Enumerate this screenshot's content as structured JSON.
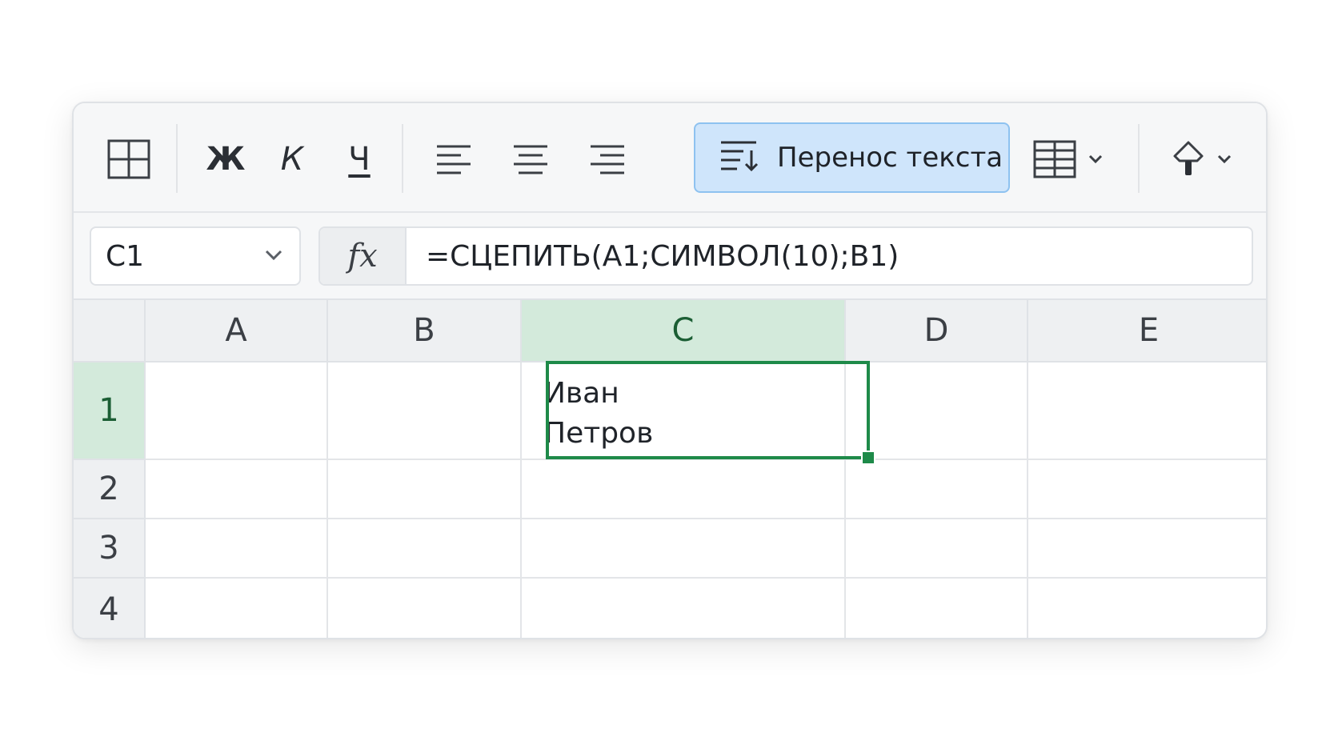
{
  "toolbar": {
    "bold_label": "Ж",
    "italic_label": "К",
    "underline_label": "Ч",
    "wrap_text_label": "Перенос текста",
    "icons": [
      "table-grid-icon",
      "align-left-icon",
      "align-center-icon",
      "align-right-icon",
      "wrap-text-icon",
      "borders-icon",
      "chevron-down-icon",
      "fill-color-icon"
    ]
  },
  "formula_bar": {
    "name_box": "C1",
    "fx_label": "fx",
    "formula": "=СЦЕПИТЬ(A1;СИМВОЛ(10);B1)"
  },
  "grid": {
    "columns": [
      "A",
      "B",
      "C",
      "D",
      "E"
    ],
    "rows": [
      "1",
      "2",
      "3",
      "4"
    ],
    "selected_cell": "C1",
    "cells": {
      "C1": "Иван\nПетров"
    }
  },
  "colors": {
    "selection": "#1e8a49",
    "selected_header": "#d3eadb",
    "wrap_button_bg": "#cfe5fb",
    "wrap_button_border": "#8ec2f0"
  }
}
